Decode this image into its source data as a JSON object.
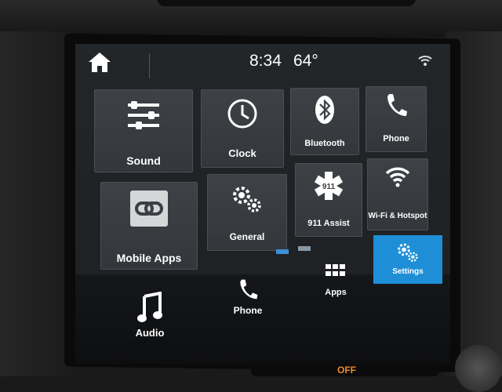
{
  "status": {
    "time": "8:34",
    "temperature": "64°"
  },
  "apps": [
    {
      "label": "Sound",
      "icon": "sliders-icon"
    },
    {
      "label": "Clock",
      "icon": "clock-icon"
    },
    {
      "label": "Bluetooth",
      "icon": "bluetooth-icon"
    },
    {
      "label": "Phone",
      "icon": "phone-icon"
    },
    {
      "label": "Mobile Apps",
      "icon": "link-icon"
    },
    {
      "label": "General",
      "icon": "gears-icon"
    },
    {
      "label": "911 Assist",
      "icon": "star-of-life-icon",
      "badge": "911"
    },
    {
      "label": "Wi-Fi & Hotspot",
      "icon": "wifi-icon"
    }
  ],
  "pager": {
    "current_page": 1,
    "page_count": 2
  },
  "nav": {
    "audio": "Audio",
    "phone": "Phone",
    "apps": "Apps",
    "settings": "Settings",
    "active": "Settings"
  },
  "console": {
    "off_label": "OFF"
  },
  "colors": {
    "accent": "#1e8fd6",
    "tile": "#3b3f44",
    "screen_bg": "#202326"
  }
}
